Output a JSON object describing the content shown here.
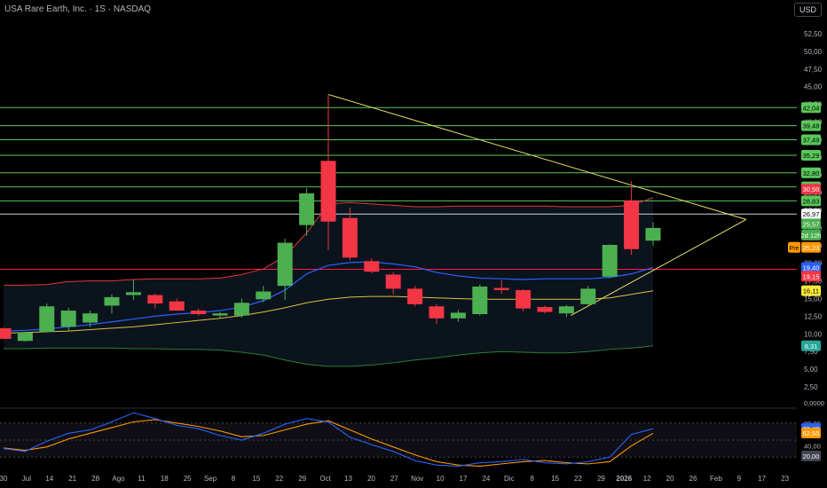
{
  "header": {
    "symbol_line": "USA Rare Earth, Inc. · 1S · NASDAQ"
  },
  "currency_button": "USD",
  "colors": {
    "up": "#4caf50",
    "down": "#f23645",
    "hline": "#5ac85a",
    "red_line": "#ff1744",
    "blue": "#2962ff",
    "orange": "#ff9800",
    "yellow": "#e8e26a",
    "axis": "#787b86"
  },
  "chart_data": {
    "type": "candlestick",
    "y_axis": {
      "scale": "log",
      "range": [
        0,
        55
      ],
      "ticks": [
        "52,50",
        "50,00",
        "47,50",
        "45,00",
        "42,50",
        "40,00",
        "37,50",
        "35,00",
        "32,50",
        "30,00",
        "27,50",
        "25,00",
        "22,50",
        "20,00",
        "17,50",
        "15,00",
        "12,50",
        "10,00",
        "7,50",
        "5,00",
        "2,50"
      ]
    },
    "x_axis": {
      "ticks": [
        "30",
        "Jul",
        "14",
        "21",
        "28",
        "Ago",
        "11",
        "18",
        "25",
        "Sep",
        "8",
        "15",
        "22",
        "29",
        "Oct",
        "13",
        "20",
        "27",
        "Nov",
        "10",
        "17",
        "24",
        "Dic",
        "8",
        "15",
        "22",
        "29",
        "2026",
        "12",
        "20",
        "26",
        "Feb",
        "9",
        "17",
        "23"
      ]
    },
    "candles": [
      {
        "o": 10.8,
        "h": 10.9,
        "l": 9.3,
        "c": 9.3
      },
      {
        "o": 9.0,
        "h": 10.3,
        "l": 8.9,
        "c": 10.2
      },
      {
        "o": 10.3,
        "h": 14.3,
        "l": 10.2,
        "c": 13.9
      },
      {
        "o": 11.0,
        "h": 13.7,
        "l": 10.4,
        "c": 13.3
      },
      {
        "o": 11.6,
        "h": 13.3,
        "l": 11.0,
        "c": 12.9
      },
      {
        "o": 14.0,
        "h": 15.6,
        "l": 12.9,
        "c": 15.2
      },
      {
        "o": 15.5,
        "h": 17.7,
        "l": 14.8,
        "c": 15.9
      },
      {
        "o": 15.5,
        "h": 15.7,
        "l": 13.6,
        "c": 14.3
      },
      {
        "o": 14.6,
        "h": 15.0,
        "l": 13.3,
        "c": 13.3
      },
      {
        "o": 13.3,
        "h": 13.6,
        "l": 12.6,
        "c": 12.8
      },
      {
        "o": 12.6,
        "h": 13.1,
        "l": 12.3,
        "c": 12.9
      },
      {
        "o": 12.6,
        "h": 15.0,
        "l": 12.3,
        "c": 14.4
      },
      {
        "o": 14.9,
        "h": 16.8,
        "l": 14.5,
        "c": 16.0
      },
      {
        "o": 16.8,
        "h": 23.5,
        "l": 14.8,
        "c": 22.9
      },
      {
        "o": 25.4,
        "h": 30.6,
        "l": 23.9,
        "c": 29.9
      },
      {
        "o": 34.5,
        "h": 43.9,
        "l": 21.9,
        "c": 25.9
      },
      {
        "o": 26.4,
        "h": 27.9,
        "l": 20.4,
        "c": 20.8
      },
      {
        "o": 20.3,
        "h": 20.7,
        "l": 18.6,
        "c": 18.8
      },
      {
        "o": 18.4,
        "h": 18.7,
        "l": 15.6,
        "c": 16.4
      },
      {
        "o": 16.4,
        "h": 16.8,
        "l": 13.9,
        "c": 14.2
      },
      {
        "o": 13.9,
        "h": 14.2,
        "l": 11.4,
        "c": 12.2
      },
      {
        "o": 12.2,
        "h": 13.4,
        "l": 11.7,
        "c": 13.0
      },
      {
        "o": 12.8,
        "h": 17.0,
        "l": 12.6,
        "c": 16.7
      },
      {
        "o": 16.5,
        "h": 17.6,
        "l": 15.7,
        "c": 16.2
      },
      {
        "o": 16.2,
        "h": 16.3,
        "l": 13.2,
        "c": 13.6
      },
      {
        "o": 13.8,
        "h": 14.0,
        "l": 12.9,
        "c": 13.1
      },
      {
        "o": 12.9,
        "h": 14.1,
        "l": 12.4,
        "c": 13.9
      },
      {
        "o": 14.2,
        "h": 16.8,
        "l": 14.1,
        "c": 16.4
      },
      {
        "o": 18.1,
        "h": 22.7,
        "l": 17.9,
        "c": 22.6
      },
      {
        "o": 28.9,
        "h": 31.6,
        "l": 21.2,
        "c": 22.0
      },
      {
        "o": 23.2,
        "h": 25.8,
        "l": 22.5,
        "c": 25.0
      }
    ],
    "horizontal_levels": [
      {
        "value": 42.04,
        "label": "42,04"
      },
      {
        "value": 39.48,
        "label": "39,48"
      },
      {
        "value": 37.49,
        "label": "37,49"
      },
      {
        "value": 35.29,
        "label": "35,29"
      },
      {
        "value": 32.8,
        "label": "32,80"
      },
      {
        "value": 30.81,
        "label": "30,81"
      },
      {
        "value": 28.83,
        "label": "28,83"
      }
    ],
    "markers": [
      {
        "value": 30.5,
        "label": "30,50",
        "color": "#f23645"
      },
      {
        "value": 26.97,
        "label": "26,97",
        "color": "#ffffff",
        "text": "#000000"
      },
      {
        "value": 25.57,
        "label": "25,57",
        "color": "#4caf50"
      },
      {
        "value": 24.0,
        "label": "2d 12h",
        "color": "#4caf50"
      },
      {
        "value": 22.25,
        "label": "25,23",
        "tag": "Pre",
        "color": "#ff9800"
      },
      {
        "value": 19.4,
        "label": "19,40",
        "color": "#2962ff"
      },
      {
        "value": 18.15,
        "label": "19,15",
        "color": "#f23645"
      },
      {
        "value": 16.11,
        "label": "16,11",
        "color": "#ffeb3b",
        "text": "#000000"
      },
      {
        "value": 8.31,
        "label": "8,31",
        "color": "#26a69a"
      }
    ],
    "overlays": {
      "red_level": 19.15,
      "upper_band": [
        16.9,
        16.9,
        17.0,
        17.4,
        17.5,
        17.5,
        17.7,
        17.8,
        17.8,
        17.8,
        17.9,
        18.4,
        19.2,
        21.0,
        24.3,
        28.4,
        28.6,
        28.4,
        28.2,
        28.0,
        28.0,
        28.1,
        28.1,
        28.1,
        28.1,
        28.1,
        28.0,
        28.0,
        28.0,
        28.2,
        29.3
      ],
      "middle_line": [
        10.4,
        10.5,
        10.7,
        11.0,
        11.3,
        11.7,
        12.1,
        12.5,
        12.8,
        13.0,
        13.3,
        13.8,
        14.7,
        16.2,
        18.5,
        19.7,
        20.1,
        20.2,
        19.9,
        19.5,
        18.7,
        18.2,
        17.9,
        17.8,
        17.7,
        17.8,
        17.8,
        17.8,
        18.0,
        18.5,
        19.4
      ],
      "yellow_line": [
        10.1,
        10.2,
        10.3,
        10.4,
        10.6,
        10.8,
        11.0,
        11.3,
        11.6,
        11.9,
        12.2,
        12.6,
        13.1,
        13.7,
        14.4,
        14.9,
        15.2,
        15.3,
        15.3,
        15.2,
        15.1,
        15.0,
        14.9,
        14.9,
        14.9,
        14.9,
        14.9,
        14.9,
        15.1,
        15.6,
        16.1
      ],
      "lower_band": [
        7.9,
        7.9,
        8.0,
        8.0,
        8.0,
        8.0,
        7.9,
        7.9,
        7.8,
        7.8,
        7.7,
        7.4,
        7.0,
        6.3,
        5.7,
        5.4,
        5.4,
        5.6,
        5.9,
        6.3,
        6.6,
        7.0,
        7.3,
        7.5,
        7.4,
        7.3,
        7.3,
        7.5,
        7.8,
        8.0,
        8.3
      ],
      "trendlines": [
        {
          "from": [
            15,
            43.9
          ],
          "to": [
            34.3,
            26.2
          ]
        },
        {
          "from": [
            26.2,
            12.6
          ],
          "to": [
            34.3,
            26.2
          ]
        }
      ]
    },
    "oscillator": {
      "ticks": [
        "80,00",
        "40,00",
        "0,0000"
      ],
      "upper": 80,
      "lower": 20,
      "blue": [
        35,
        30,
        48,
        62,
        68,
        82,
        98,
        88,
        76,
        70,
        58,
        50,
        62,
        78,
        88,
        82,
        55,
        42,
        30,
        14,
        6,
        4,
        10,
        12,
        16,
        10,
        8,
        12,
        20,
        60,
        70
      ],
      "orange": [
        36,
        32,
        38,
        52,
        62,
        72,
        82,
        86,
        80,
        74,
        66,
        56,
        58,
        68,
        78,
        84,
        68,
        52,
        38,
        24,
        12,
        6,
        4,
        8,
        12,
        14,
        10,
        8,
        12,
        40,
        62
      ],
      "labels": [
        {
          "value": 70.42,
          "label": "70,42",
          "color": "#2962ff"
        },
        {
          "value": 62.55,
          "label": "62,55",
          "color": "#ff9800"
        },
        {
          "value": 22,
          "label": "20,00",
          "color": "#434651"
        }
      ],
      "top_label": "80,00"
    }
  }
}
